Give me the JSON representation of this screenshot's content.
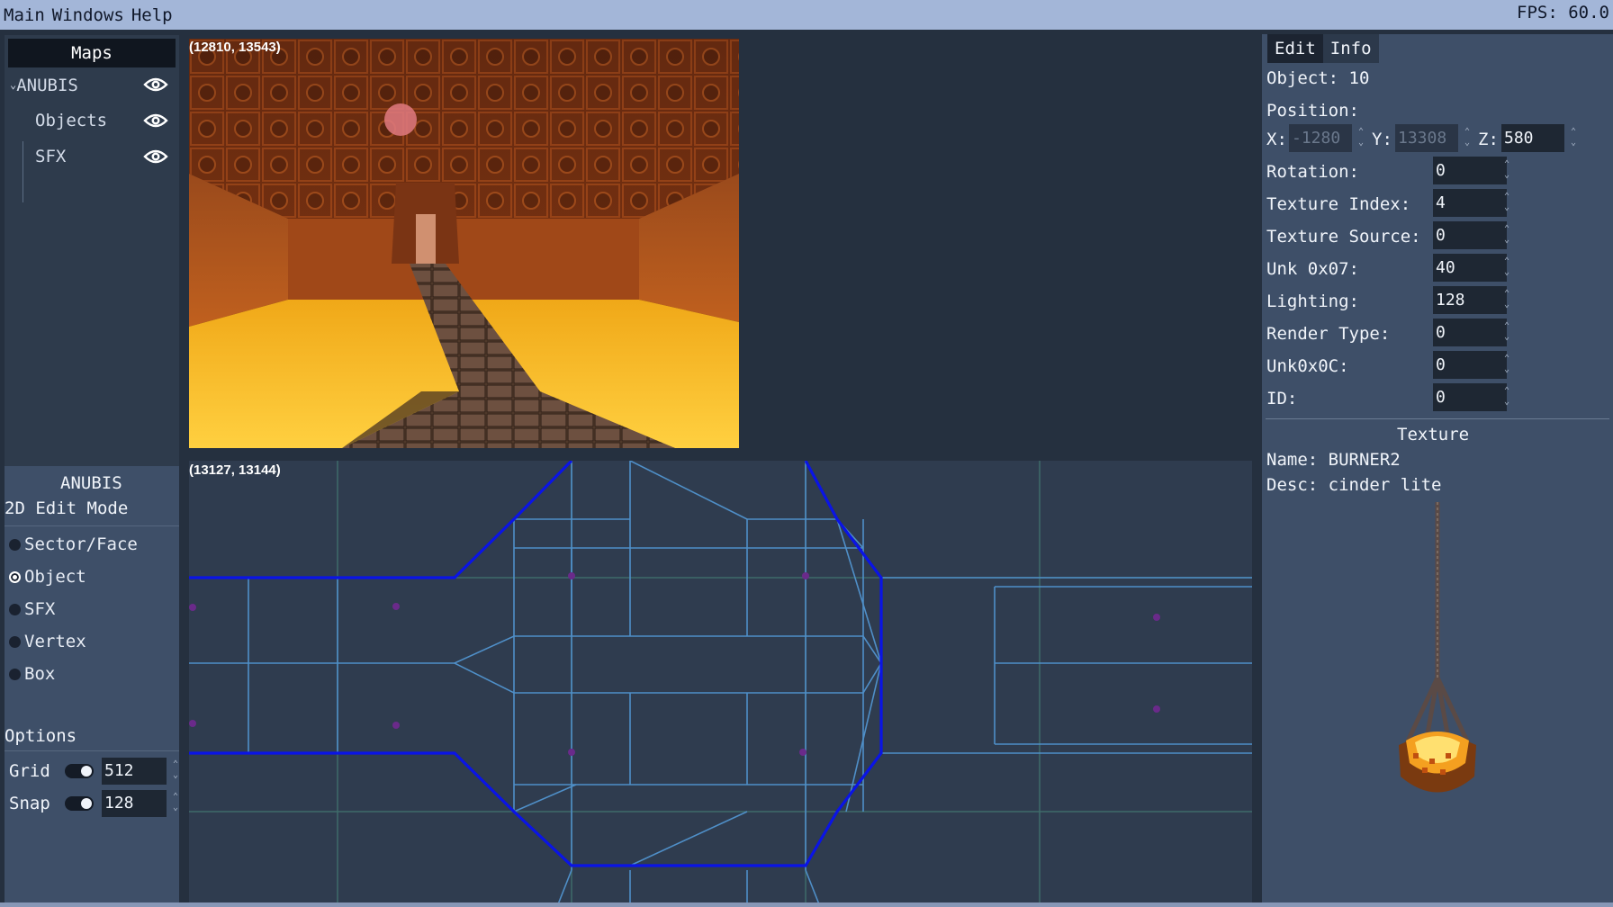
{
  "menubar": {
    "items": [
      "Main",
      "Windows",
      "Help"
    ],
    "fps": "FPS: 60.0"
  },
  "maps_panel": {
    "header": "Maps",
    "tree": [
      {
        "label": "ANUBIS",
        "icon": "eye-icon"
      },
      {
        "label": "Objects",
        "icon": "eye-icon"
      },
      {
        "label": "SFX",
        "icon": "eye-icon"
      }
    ]
  },
  "mode_panel": {
    "map_name": "ANUBIS",
    "mode_title": "2D Edit Mode",
    "modes": [
      "Sector/Face",
      "Object",
      "SFX",
      "Vertex",
      "Box"
    ],
    "selected_mode": "Object",
    "options_title": "Options",
    "grid_label": "Grid",
    "grid_value": "512",
    "snap_label": "Snap",
    "snap_value": "128"
  },
  "viewport_3d": {
    "coords": "(12810, 13543)"
  },
  "viewport_2d": {
    "coords": "(13127, 13144)"
  },
  "inspector": {
    "tabs": [
      "Edit",
      "Info"
    ],
    "active_tab": "Edit",
    "object_title": "Object: 10",
    "position_label": "Position:",
    "x_label": "X:",
    "x_value": "-1280",
    "y_label": "Y:",
    "y_value": "13308",
    "z_label": "Z:",
    "z_value": "580",
    "fields": [
      {
        "label": "Rotation:",
        "value": "0"
      },
      {
        "label": "Texture Index:",
        "value": "4"
      },
      {
        "label": "Texture Source:",
        "value": "0"
      },
      {
        "label": "Unk 0x07:",
        "value": "40"
      },
      {
        "label": "Lighting:",
        "value": "128"
      },
      {
        "label": "Render Type:",
        "value": "0"
      },
      {
        "label": "Unk0x0C:",
        "value": "0"
      },
      {
        "label": "ID:",
        "value": "0"
      }
    ],
    "texture_title": "Texture",
    "texture_name": "Name: BURNER2",
    "texture_desc": "Desc: cinder lite"
  },
  "colors": {
    "accent_blue": "#0a14e6",
    "grid_line": "#4f7fb8",
    "object_dot": "#6a2a8a"
  }
}
